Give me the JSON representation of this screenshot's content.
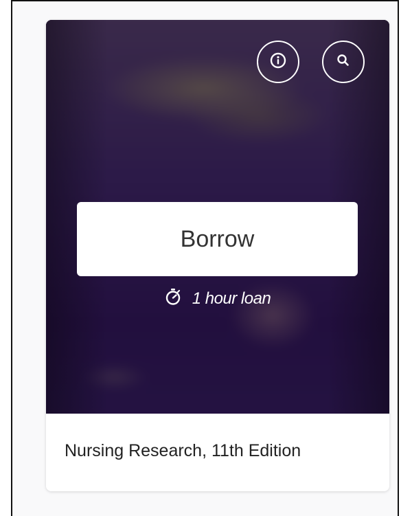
{
  "card": {
    "title": "Nursing Research, 11th Edition",
    "borrow_label": "Borrow",
    "loan_text": "1 hour loan",
    "icons": {
      "info": "info-icon",
      "search": "search-icon",
      "timer": "stopwatch-icon"
    }
  },
  "colors": {
    "cover_bg": "#2a1644",
    "button_bg": "#ffffff",
    "button_text": "#333333",
    "title_text": "#222222"
  }
}
